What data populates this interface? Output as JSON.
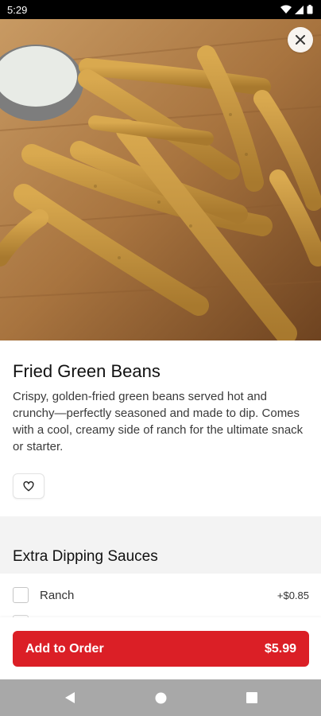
{
  "status_bar": {
    "time": "5:29"
  },
  "item": {
    "title": "Fried Green Beans",
    "description": "Crispy, golden-fried green beans served hot and crunchy—perfectly seasoned and made to dip. Comes with a cool, creamy side of ranch for the ultimate snack or starter."
  },
  "options": {
    "section_title": "Extra Dipping Sauces",
    "items": [
      {
        "label": "Ranch",
        "price": "+$0.85",
        "checked": false
      }
    ]
  },
  "order": {
    "label": "Add to Order",
    "price": "$5.99"
  },
  "colors": {
    "accent": "#db1f26",
    "nav_bar": "#a8a8a8",
    "band": "#f3f3f3"
  },
  "icons": [
    "wifi-icon",
    "signal-icon",
    "battery-icon",
    "close-icon",
    "heart-icon",
    "back-icon",
    "home-icon",
    "recents-icon"
  ]
}
